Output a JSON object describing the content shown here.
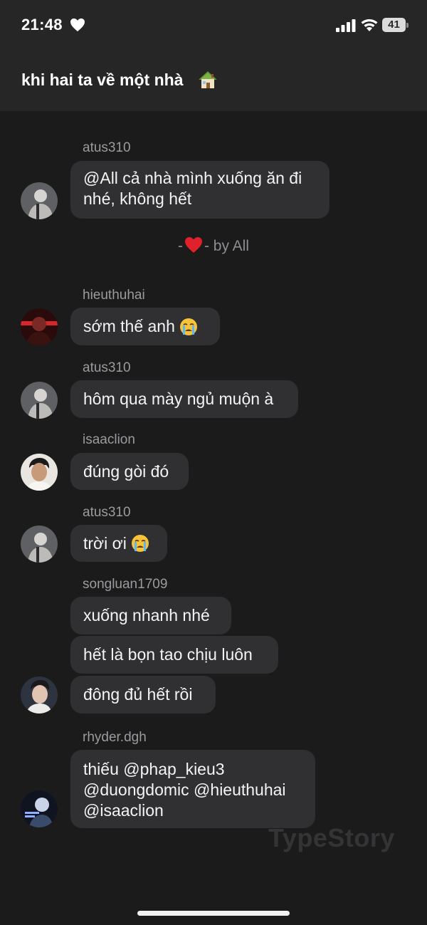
{
  "status_bar": {
    "time": "21:48",
    "battery": "41",
    "icons": [
      "heart-icon",
      "signal-icon",
      "wifi-icon",
      "battery-icon"
    ]
  },
  "header": {
    "title": "khi hai ta về một nhà",
    "title_icon": "house-icon"
  },
  "messages": [
    {
      "sender": "atus310",
      "bubbles": [
        "@All cả nhà mình xuống ăn đi\nnhé, không hết"
      ]
    },
    {
      "sender": "hieuthuhai",
      "bubbles": [
        "sớm thế anh"
      ],
      "emoji": "crying-face-icon"
    },
    {
      "sender": "atus310",
      "bubbles": [
        "hôm qua mày ngủ muộn à"
      ]
    },
    {
      "sender": "isaaclion",
      "bubbles": [
        "đúng gòi đó"
      ]
    },
    {
      "sender": "atus310",
      "bubbles": [
        "trời ơi"
      ],
      "emoji": "crying-face-icon"
    },
    {
      "sender": "songluan1709",
      "bubbles": [
        "xuống nhanh nhé",
        "hết là bọn tao chịu luôn",
        "đông đủ hết rồi"
      ]
    },
    {
      "sender": "rhyder.dgh",
      "bubbles": [
        "thiếu @phap_kieu3\n@duongdomic @hieuthuhai\n@isaaclion"
      ]
    }
  ],
  "reaction": {
    "prefix": "-",
    "suffix": "- by All",
    "icon": "red-heart-icon"
  },
  "watermark": "TypeStory",
  "colors": {
    "background": "#1b1b1c",
    "header": "#262627",
    "bubble": "#303032",
    "sender_text": "#9b9b9f",
    "heart": "#e0202a"
  }
}
